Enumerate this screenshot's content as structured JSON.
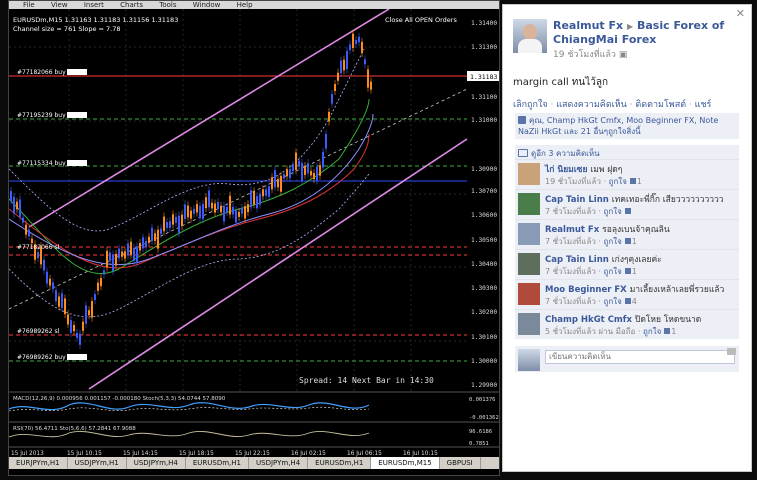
{
  "menubar": {
    "items": [
      "File",
      "View",
      "Insert",
      "Charts",
      "Tools",
      "Window",
      "Help"
    ]
  },
  "chart": {
    "header_line1": "EURUSDm,M15  1.31163 1.31183 1.31156 1.31183",
    "header_line2": "Channel size = 761 Slope = 7.78",
    "button": "Close All OPEN Orders",
    "current_price": "1.31183",
    "spread_text": "Spread: 14  Next Bar in 14:30",
    "orders": [
      "#77182066 buy",
      "#77195239 buy",
      "#77115334 buy",
      "#77182066 sl",
      "#76989262 sl",
      "#76989262 buy"
    ],
    "price_labels": [
      "1.31400",
      "1.31300",
      "1.31100",
      "1.31000",
      "1.30900",
      "1.30700",
      "1.30600",
      "1.30500",
      "1.30400",
      "1.30300",
      "1.30200",
      "1.30100",
      "1.30000",
      "1.29900"
    ],
    "time_labels": [
      "15 Jul 2013",
      "15 Jul 10:15",
      "15 Jul 14:15",
      "15 Jul 18:15",
      "15 Jul 22:15",
      "16 Jul 02:15",
      "16 Jul 06:15",
      "16 Jul 10:15"
    ],
    "macd_label": "MACD(12,26,9) 0.000956 0.001157 -0.000180  Stoch(5,3,3) 54.0744 57.8090",
    "macd_right": [
      "0.001376",
      "-0.001362"
    ],
    "rsi_label": "RSI(70) 56.4711  Sto(5,6,6) 57.2841 67.9088",
    "rsi_right": [
      "96.6186",
      "0.7851"
    ]
  },
  "tabs": [
    "EURJPYm,H1",
    "USDJPYm,H1",
    "USDJPYm,H4",
    "EURUSDm,H1",
    "USDJPYm,H4",
    "EURUSDm,H1",
    "EURUSDm,M15",
    "GBPUSI"
  ],
  "post": {
    "author": "Realmut Fx",
    "group": "Basic Forex of ChiangMai Forex",
    "time": "19 ชั่วโมงที่แล้ว",
    "text": "margin call ทนไว้ลูก",
    "actions": [
      "เลิกถูกใจ",
      "แสดงความคิดเห็น",
      "ติดตามโพสต์",
      "แชร์"
    ],
    "likes_text": "คุณ, Champ HkGt Cmfx, Moo Beginner FX, Note NaZii HkGt และ 21 อื่นๆถูกใจสิ่งนี้",
    "view_comments": "ดูอีก 3 ความคิดเห็น",
    "comment_placeholder": "เขียนความคิดเห็น"
  },
  "comments": [
    {
      "name": "ไก่ นิยมเซย",
      "text": "เมพ ฝุดๆ",
      "time": "19 ชั่วโมงที่แล้ว",
      "like": "ถูกใจ",
      "likes": "1"
    },
    {
      "name": "Cap Tain Linn",
      "text": "เทคเทอะพี่กิ๊ก เสียวววววววววว",
      "time": "7 ชั่วโมงที่แล้ว",
      "like": "ถูกใจ",
      "likes": ""
    },
    {
      "name": "Realmut Fx",
      "text": "รอลุงเบนจ้าคุณลิน",
      "time": "7 ชั่วโมงที่แล้ว",
      "like": "ถูกใจ",
      "likes": "1"
    },
    {
      "name": "Cap Tain Linn",
      "text": "เก่งๆคุงเลยค่ะ",
      "time": "7 ชั่วโมงที่แล้ว",
      "like": "ถูกใจ",
      "likes": "1"
    },
    {
      "name": "Moo Beginner FX",
      "text": "มาเลี้ยงเหล้าเลยพี่รวยแล้ว",
      "time": "7 ชั่วโมงที่แล้ว",
      "like": "ถูกใจ",
      "likes": "4"
    },
    {
      "name": "Champ HkGt Cmfx",
      "text": "ปิดโหย โหดขนาด",
      "time": "5 ชั่วโมงที่แล้ว ผ่าน มือถือ",
      "like": "ถูกใจ",
      "likes": "1"
    }
  ],
  "colors": {
    "fb_blue": "#3b5998",
    "channel": "#e08ae8",
    "bull": "#3a5cff",
    "bear": "#ff8c1a",
    "price_line": "#ff3b3b"
  }
}
